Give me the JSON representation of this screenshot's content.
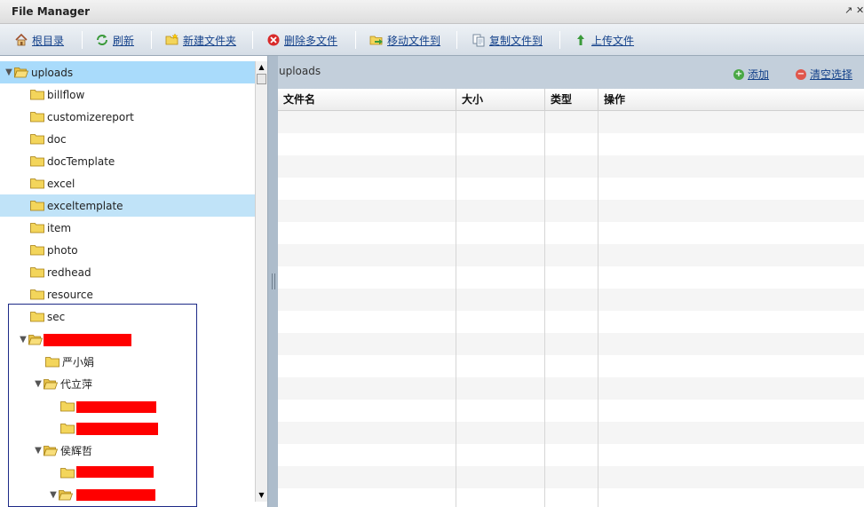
{
  "window": {
    "title": "File Manager"
  },
  "toolbar": {
    "buttons": [
      {
        "label": "根目录",
        "icon": "home-icon"
      },
      {
        "label": "刷新",
        "icon": "refresh-icon"
      },
      {
        "label": "新建文件夹",
        "icon": "new-folder-icon"
      },
      {
        "label": "删除多文件",
        "icon": "delete-icon"
      },
      {
        "label": "移动文件到",
        "icon": "move-icon"
      },
      {
        "label": "复制文件到",
        "icon": "copy-icon"
      },
      {
        "label": "上传文件",
        "icon": "upload-icon"
      }
    ]
  },
  "tree": {
    "nodes": [
      {
        "label": "uploads",
        "expanded": true,
        "selected": true
      },
      {
        "label": "billflow"
      },
      {
        "label": "customizereport"
      },
      {
        "label": "doc"
      },
      {
        "label": "docTemplate"
      },
      {
        "label": "excel"
      },
      {
        "label": "exceltemplate",
        "hovered": true
      },
      {
        "label": "item"
      },
      {
        "label": "photo"
      },
      {
        "label": "redhead"
      },
      {
        "label": "resource"
      },
      {
        "label": "sec"
      },
      {
        "label": "",
        "expanded": true,
        "redacted": true
      },
      {
        "label": "严小娟"
      },
      {
        "label": "代立萍",
        "expanded": true
      },
      {
        "label": "",
        "redacted": true
      },
      {
        "label": "",
        "redacted": true
      },
      {
        "label": "侯辉哲",
        "expanded": true
      },
      {
        "label": "",
        "redacted": true
      },
      {
        "label": "",
        "expanded": true,
        "redacted": true
      }
    ]
  },
  "content": {
    "path": "uploads",
    "actions": {
      "add": "添加",
      "clear": "清空选择"
    },
    "columns": [
      "文件名",
      "大小",
      "类型",
      "操作"
    ],
    "rows": []
  },
  "colors": {
    "selection": "#a9dbfb",
    "link": "#15428b",
    "panel": "#adbccb",
    "redaction": "#ff0000",
    "annotation_box": "#1d2a87"
  }
}
